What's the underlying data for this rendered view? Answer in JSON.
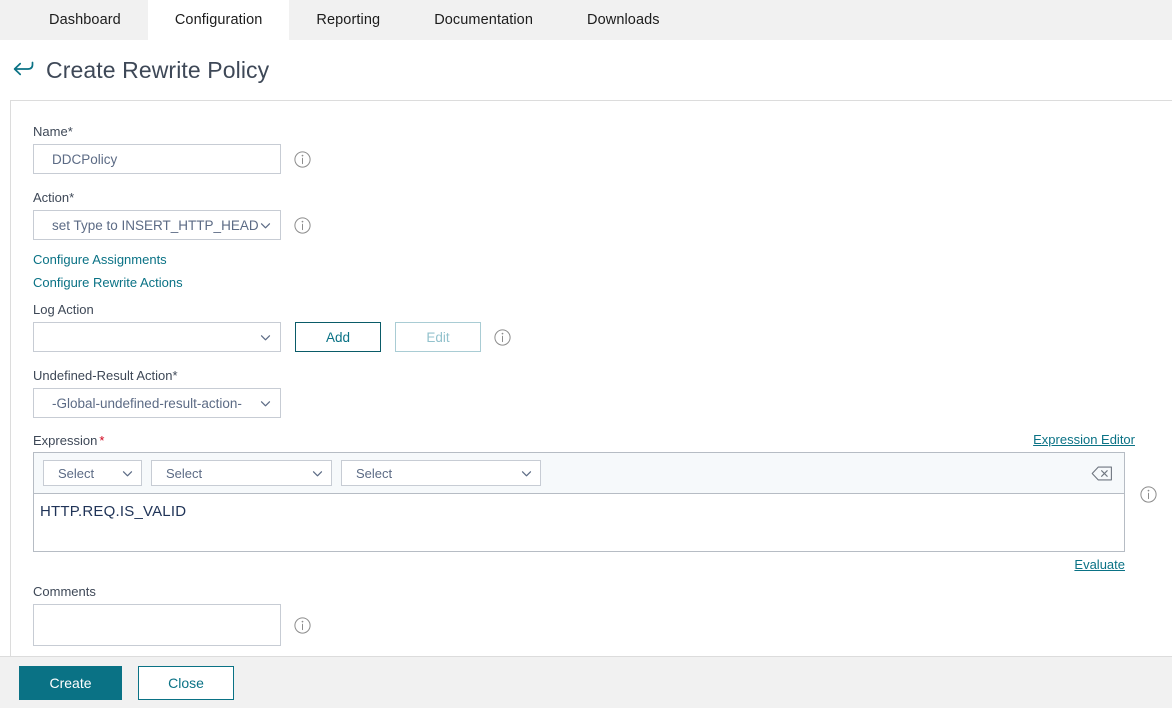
{
  "nav": {
    "tabs": [
      {
        "label": "Dashboard",
        "active": false
      },
      {
        "label": "Configuration",
        "active": true
      },
      {
        "label": "Reporting",
        "active": false
      },
      {
        "label": "Documentation",
        "active": false
      },
      {
        "label": "Downloads",
        "active": false
      }
    ]
  },
  "header": {
    "title": "Create Rewrite Policy",
    "back_icon": "back-arrow-icon"
  },
  "form": {
    "name": {
      "label": "Name",
      "required_mark": "*",
      "value": "DDCPolicy",
      "placeholder": "",
      "info_icon": "info-icon"
    },
    "action": {
      "label": "Action",
      "required_mark": "*",
      "value": "set Type to INSERT_HTTP_HEADER",
      "info_icon": "info-icon"
    },
    "links": {
      "configure_assignments": "Configure Assignments",
      "configure_rewrite_actions": "Configure Rewrite Actions"
    },
    "log_action": {
      "label": "Log Action",
      "value": "",
      "add_button": "Add",
      "edit_button": "Edit",
      "edit_disabled": true,
      "info_icon": "info-icon"
    },
    "undefined_result_action": {
      "label": "Undefined-Result Action",
      "required_mark": "*",
      "value": "-Global-undefined-result-action-"
    },
    "expression": {
      "label": "Expression",
      "required_mark": "*",
      "editor_link": "Expression Editor",
      "selects": [
        {
          "value": "Select"
        },
        {
          "value": "Select"
        },
        {
          "value": "Select"
        }
      ],
      "erase_icon": "backspace-erase-icon",
      "value": "HTTP.REQ.IS_VALID",
      "evaluate_link": "Evaluate",
      "info_icon": "info-icon"
    },
    "comments": {
      "label": "Comments",
      "value": "",
      "placeholder": "",
      "info_icon": "info-icon"
    }
  },
  "footer": {
    "create_label": "Create",
    "close_label": "Close"
  },
  "colors": {
    "accent_teal": "#0a7285",
    "title_slate": "#3e4857",
    "tabbar_bg": "#f1f1f1",
    "required_red": "#d0021b",
    "expr_text": "#1f3357"
  }
}
